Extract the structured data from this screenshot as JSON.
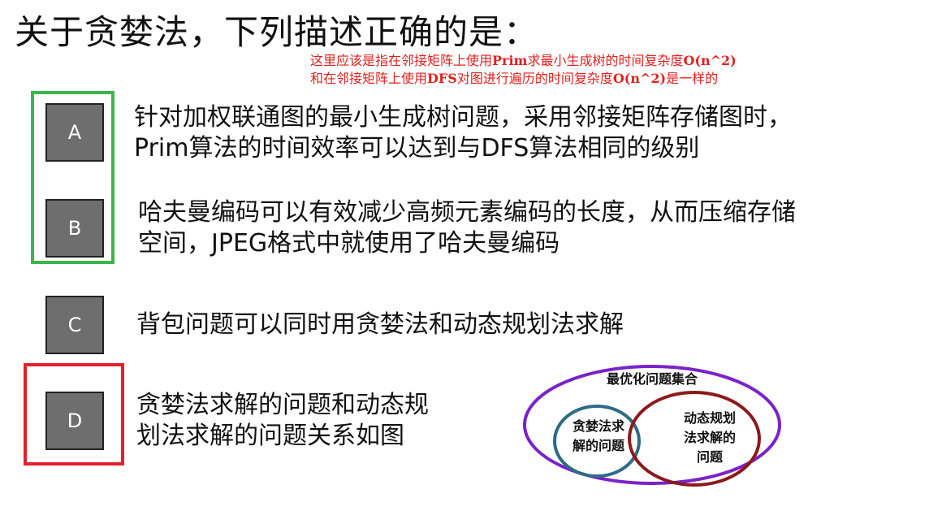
{
  "question": {
    "title": "关于贪婪法，下列描述正确的是："
  },
  "annotation": {
    "line1_a": "这里应该是指在邻接矩阵上使用",
    "line1_b": "Prim",
    "line1_c": "求最小生成树的时间复杂度",
    "line1_d": "O(n^2)",
    "line2_a": "和在邻接矩阵上使用",
    "line2_b": "DFS",
    "line2_c": "对图进行遍历的时间复杂度",
    "line2_d": "O(n^2)",
    "line2_e": "是一样的",
    "color": "#e3201e"
  },
  "options": [
    {
      "letter": "A",
      "line1": "针对加权联通图的最小生成树问题，采用邻接矩阵存储图时，",
      "line2": "Prim算法的时间效率可以达到与DFS算法相同的级别"
    },
    {
      "letter": "B",
      "line1": "哈夫曼编码可以有效减少高频元素编码的长度，从而压缩存储",
      "line2": "空间，JPEG格式中就使用了哈夫曼编码"
    },
    {
      "letter": "C",
      "line1": "背包问题可以同时用贪婪法和动态规划法求解"
    },
    {
      "letter": "D",
      "line1": "贪婪法求解的问题和动态规",
      "line2": "划法求解的问题关系如图"
    }
  ],
  "highlight": {
    "correct_color": "#3cb54a",
    "wrong_color": "#e5202a"
  },
  "venn": {
    "outer_label": "最优化问题集合",
    "left_label_1": "贪婪法求",
    "left_label_2": "解的问题",
    "right_label_1": "动态规划",
    "right_label_2": "法求解的",
    "right_label_3": "问题",
    "outer_color": "#7a22c9",
    "left_color": "#2d6b86",
    "right_color": "#8c1a1a"
  }
}
